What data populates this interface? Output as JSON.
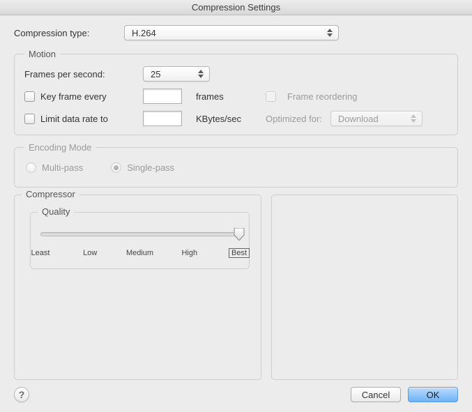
{
  "window": {
    "title": "Compression Settings"
  },
  "compression": {
    "label": "Compression type:",
    "selected": "H.264"
  },
  "motion": {
    "legend": "Motion",
    "fps_label": "Frames per second:",
    "fps_selected": "25",
    "keyframe_label": "Key frame every",
    "keyframe_value": "",
    "keyframe_unit": "frames",
    "frame_reordering_label": "Frame reordering",
    "limit_label": "Limit data rate to",
    "limit_value": "",
    "limit_unit": "KBytes/sec",
    "optimized_label": "Optimized for:",
    "optimized_selected": "Download"
  },
  "encoding": {
    "legend": "Encoding Mode",
    "multi_pass_label": "Multi-pass",
    "single_pass_label": "Single-pass",
    "selected": "single"
  },
  "compressor": {
    "legend": "Compressor",
    "quality_legend": "Quality",
    "ticks": [
      "Least",
      "Low",
      "Medium",
      "High",
      "Best"
    ],
    "value_index": 4
  },
  "footer": {
    "help": "?",
    "cancel": "Cancel",
    "ok": "OK"
  }
}
